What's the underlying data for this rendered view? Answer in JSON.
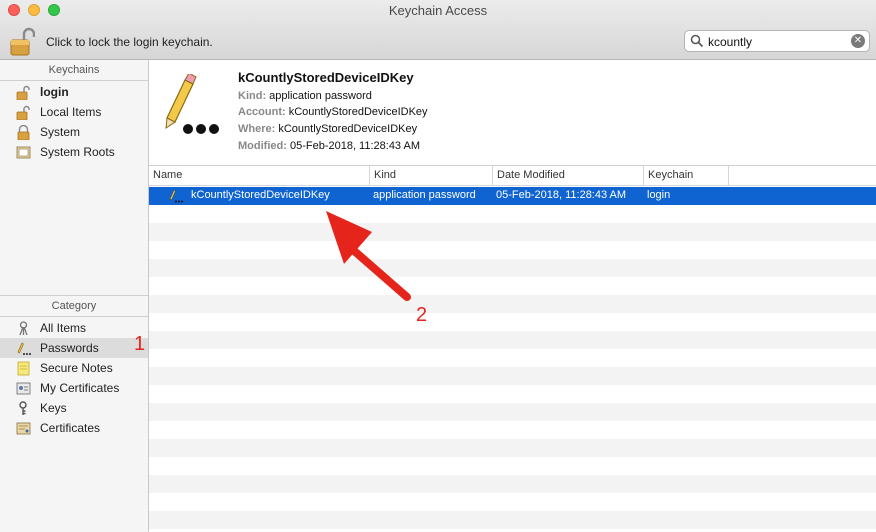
{
  "window": {
    "title": "Keychain Access"
  },
  "toolbar": {
    "lock_text": "Click to lock the login keychain.",
    "search_value": "kcountly"
  },
  "sidebar": {
    "keychains_header": "Keychains",
    "keychains": [
      {
        "label": "login",
        "icon": "lock-open-icon"
      },
      {
        "label": "Local Items",
        "icon": "lock-open-icon"
      },
      {
        "label": "System",
        "icon": "lock-closed-icon"
      },
      {
        "label": "System Roots",
        "icon": "certificate-folder-icon"
      }
    ],
    "category_header": "Category",
    "categories": [
      {
        "label": "All Items",
        "icon": "all-items-icon"
      },
      {
        "label": "Passwords",
        "icon": "password-icon"
      },
      {
        "label": "Secure Notes",
        "icon": "note-icon"
      },
      {
        "label": "My Certificates",
        "icon": "my-certificate-icon"
      },
      {
        "label": "Keys",
        "icon": "key-icon"
      },
      {
        "label": "Certificates",
        "icon": "certificate-icon"
      }
    ]
  },
  "details": {
    "name": "kCountlyStoredDeviceIDKey",
    "kind_label": "Kind:",
    "kind": "application password",
    "account_label": "Account:",
    "account": "kCountlyStoredDeviceIDKey",
    "where_label": "Where:",
    "where": "kCountlyStoredDeviceIDKey",
    "modified_label": "Modified:",
    "modified": "05-Feb-2018, 11:28:43 AM"
  },
  "table": {
    "columns": [
      "Name",
      "Kind",
      "Date Modified",
      "Keychain"
    ],
    "rows": [
      [
        "kCountlyStoredDeviceIDKey",
        "application password",
        "05-Feb-2018, 11:28:43 AM",
        "login"
      ]
    ]
  },
  "annotations": {
    "one": "1",
    "two": "2"
  },
  "colors": {
    "selection": "#0f64d2",
    "annotation": "#e5251c"
  }
}
